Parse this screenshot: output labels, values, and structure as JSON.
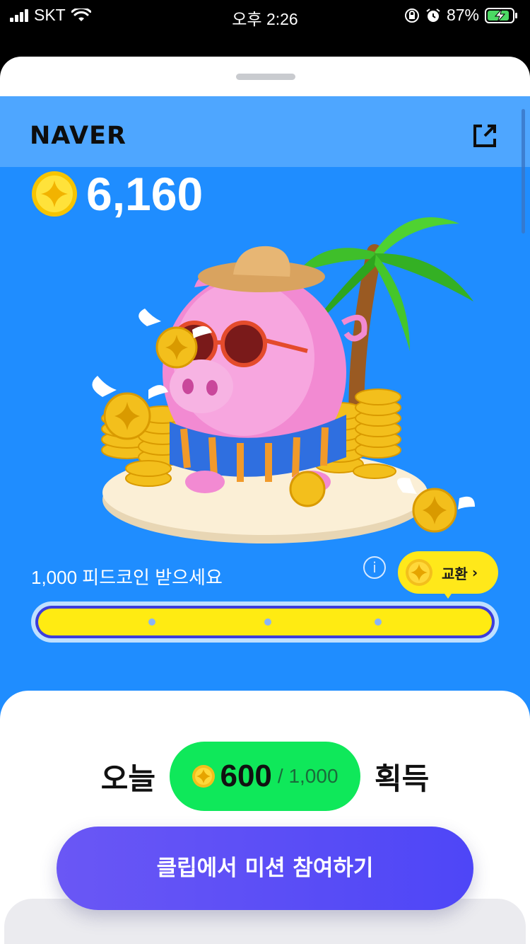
{
  "status_bar": {
    "carrier": "SKT",
    "time": "오후 2:26",
    "battery": "87%"
  },
  "header": {
    "brand": "NAVER",
    "share_icon": "share-external-icon"
  },
  "balance": {
    "amount": "6,160",
    "icon": "coin-icon"
  },
  "goal": {
    "text": "1,000 피드코인 받으세요",
    "info_icon_glyph": "i",
    "exchange_label": "교환",
    "exchange_arrow": "›",
    "progress_fraction": 1.0
  },
  "today": {
    "label_left": "오늘",
    "earned": "600",
    "max": "/ 1,000",
    "label_right": "획득"
  },
  "cta": {
    "label": "클립에서 미션 참여하기"
  },
  "colors": {
    "hero_bg": "#1f8dff",
    "progress_fill": "#ffeb12",
    "today_pill": "#0fe85a",
    "cta": "#5a4ff6"
  }
}
